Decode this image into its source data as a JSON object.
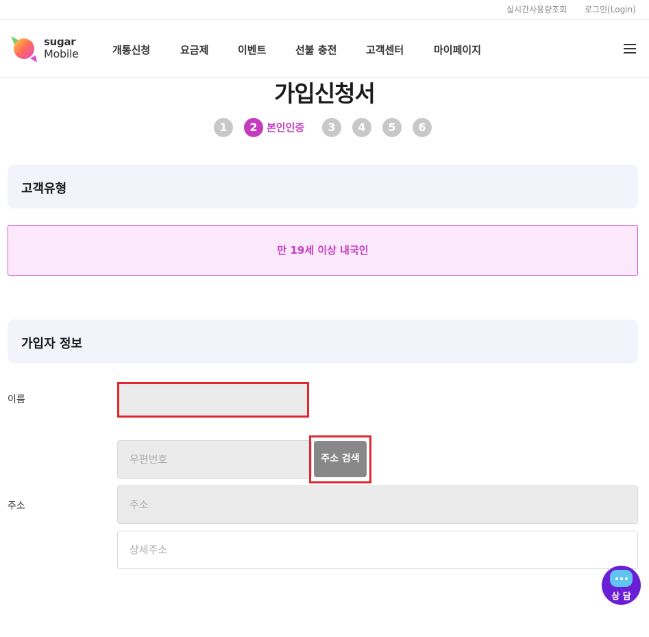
{
  "util_links": {
    "usage": "실시간사용량조회",
    "login": "로그인(Login)"
  },
  "logo": {
    "line1": "sugar",
    "line2": "Mobile"
  },
  "nav": [
    "개통신청",
    "요금제",
    "이벤트",
    "선불 충전",
    "고객센터",
    "마이페이지"
  ],
  "page_title": "가입신청서",
  "steps": {
    "items": [
      "1",
      "2",
      "3",
      "4",
      "5",
      "6"
    ],
    "active_index": 1,
    "active_label": "본인인증"
  },
  "sections": {
    "customer_type": "고객유형",
    "subscriber_info": "가입자 정보"
  },
  "customer_type_option": "만 19세 이상 내국인",
  "form": {
    "name_label": "이름",
    "name_value": "",
    "address_label": "주소",
    "zip_placeholder": "우편번호",
    "address_search_button": "주소 검색",
    "address_placeholder": "주소",
    "detail_placeholder": "상세주소"
  },
  "chat": {
    "label": "상 담"
  },
  "colors": {
    "accent": "#c43bc0",
    "highlight_outline": "#e0262e",
    "chat_bg": "#6a1fd6"
  }
}
